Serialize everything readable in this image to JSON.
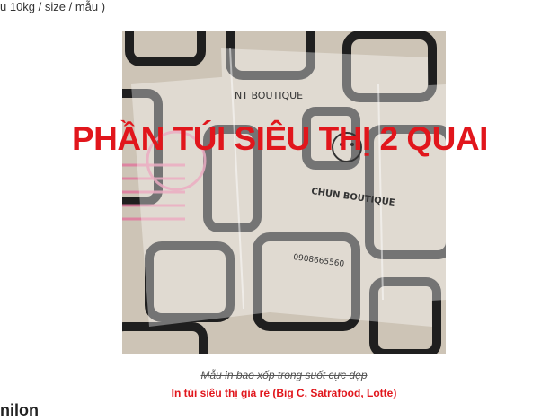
{
  "top_text": "u 10kg / size / mẫu )",
  "image": {
    "overlay_title": "PHẦN TÚI SIÊU THỊ 2 QUAI",
    "bag_text_1": "NT BOUTIQUE",
    "bag_text_2": "CHUN BOUTIQUE",
    "bag_text_3": "0908665560"
  },
  "captions": {
    "line1": "Mẫu in bao xốp trong suốt cực đẹp",
    "line2": "In túi siêu thị giá rẻ (Big C, Satrafood, Lotte)"
  },
  "partial_heading": "nilon",
  "colors": {
    "accent_red": "#e1161c"
  }
}
